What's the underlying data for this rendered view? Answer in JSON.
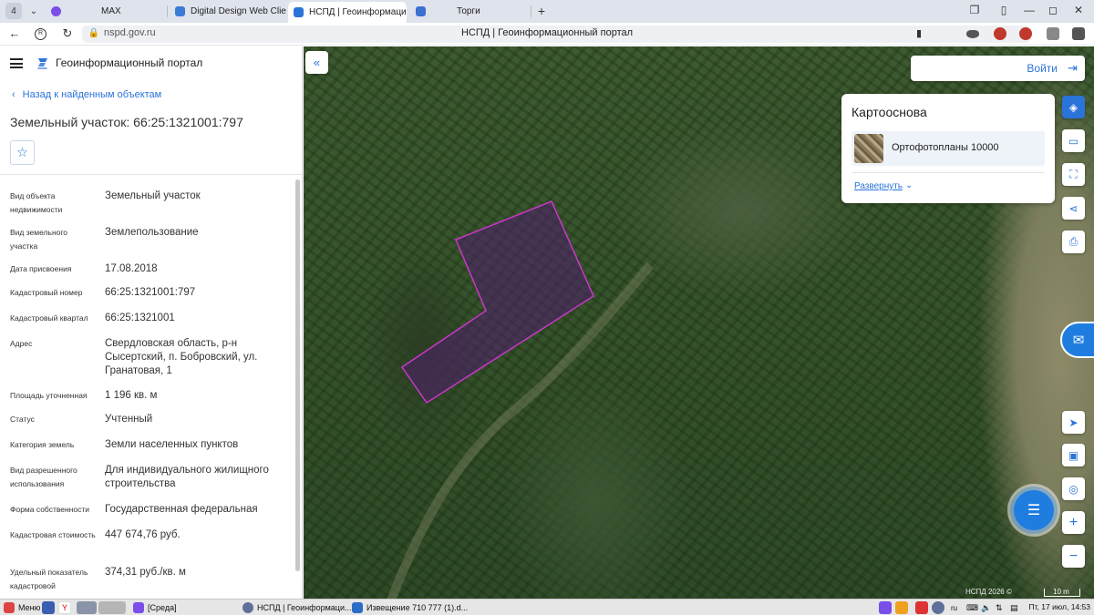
{
  "browser": {
    "tab_count": "4",
    "tabs": [
      {
        "label": "MAX",
        "favicon_color": "#7a4ee8"
      },
      {
        "label": "Digital Design Web Client",
        "favicon_color": "#3a7bd5"
      },
      {
        "label": "НСПД | Геоинформаци",
        "favicon_color": "#2a73d8",
        "active": true,
        "close": "✕"
      },
      {
        "label": "Торги",
        "favicon_color": "#3b6fd0"
      }
    ],
    "new_tab": "+",
    "url": "nspd.gov.ru",
    "page_title": "НСПД | Геоинформационный портал"
  },
  "panel": {
    "portal_title": "Геоинформационный портал",
    "back_link": "Назад к найденным объектам",
    "object_title": "Земельный участок: 66:25:1321001:797",
    "properties": [
      {
        "label": "Вид объекта недвижимости",
        "value": "Земельный участок"
      },
      {
        "label": "Вид земельного участка",
        "value": "Землепользование"
      },
      {
        "label": "Дата присвоения",
        "value": "17.08.2018"
      },
      {
        "label": "Кадастровый номер",
        "value": "66:25:1321001:797"
      },
      {
        "label": "Кадастровый квартал",
        "value": "66:25:1321001"
      },
      {
        "label": "Адрес",
        "value": "Свердловская область, р-н Сысертский, п. Бобровский, ул. Гранатовая, 1"
      },
      {
        "label": "Площадь уточненная",
        "value": "1 196 кв. м"
      },
      {
        "label": "Статус",
        "value": "Учтенный"
      },
      {
        "label": "Категория земель",
        "value": "Земли населенных пунктов"
      },
      {
        "label": "Вид разрешенного использования",
        "value": "Для индивидуального жилищного строительства"
      },
      {
        "label": "Форма собственности",
        "value": "Государственная федеральная"
      },
      {
        "label": "Кадастровая стоимость",
        "value": "447 674,76 руб."
      },
      {
        "label": "Удельный показатель кадастровой",
        "value": "374,31 руб./кв. м"
      }
    ]
  },
  "map": {
    "login_label": "Войти",
    "basemap": {
      "title": "Картооснова",
      "selected": "Ортофотопланы 10000",
      "expand_label": "Развернуть"
    },
    "copyright": "НСПД 2026 ©",
    "scale_label": "10 m",
    "parcel_color": "#c838c8"
  },
  "taskbar": {
    "menu_label": "Меню",
    "items": [
      {
        "label": "[Среда]"
      },
      {
        "label": "НСПД | Геоинформаци..."
      },
      {
        "label": "Извещение 710 777 (1).d..."
      }
    ],
    "lang": "ru",
    "clock": "Пт, 17 июл, 14:53"
  }
}
